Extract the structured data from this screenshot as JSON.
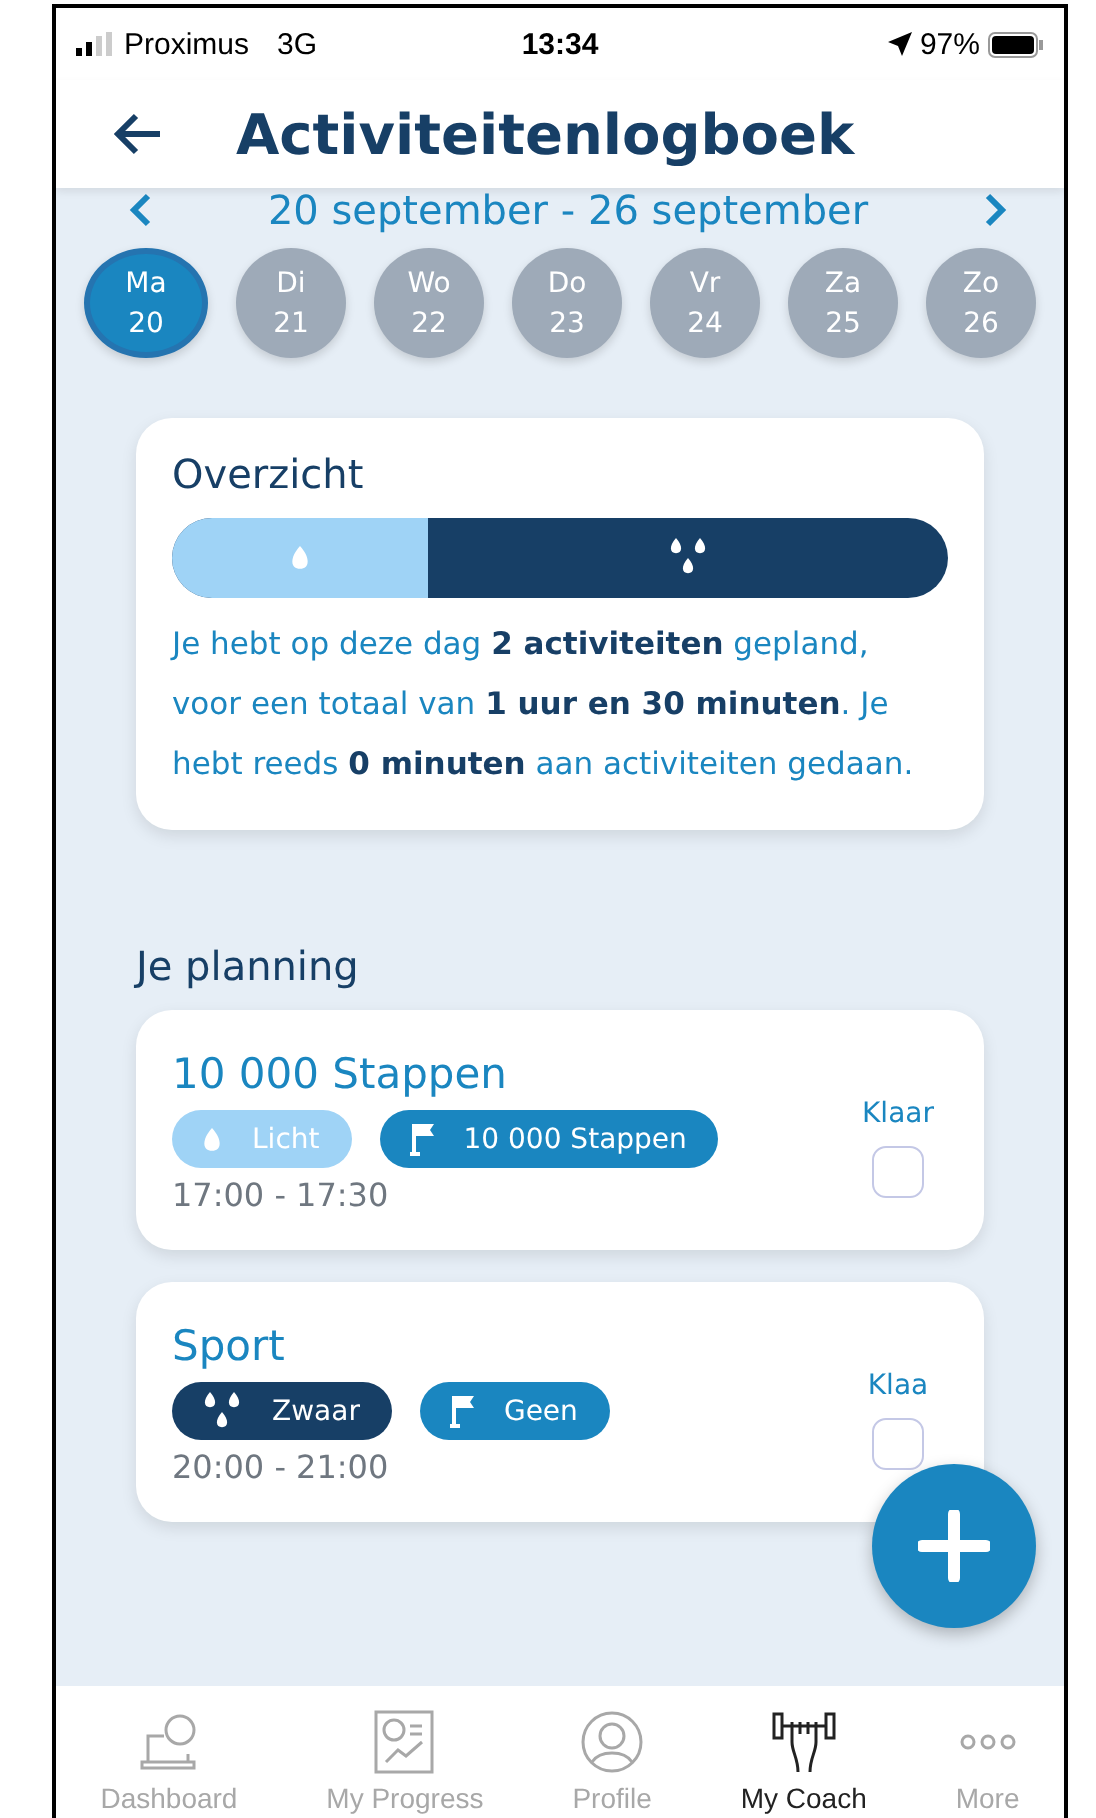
{
  "status_bar": {
    "carrier": "Proximus",
    "network": "3G",
    "time": "13:34",
    "battery": "97%"
  },
  "header": {
    "title": "Activiteitenlogboek"
  },
  "week": {
    "range": "20 september - 26 september",
    "days": [
      {
        "name": "Ma",
        "date": "20",
        "selected": true
      },
      {
        "name": "Di",
        "date": "21",
        "selected": false
      },
      {
        "name": "Wo",
        "date": "22",
        "selected": false
      },
      {
        "name": "Do",
        "date": "23",
        "selected": false
      },
      {
        "name": "Vr",
        "date": "24",
        "selected": false
      },
      {
        "name": "Za",
        "date": "25",
        "selected": false
      },
      {
        "name": "Zo",
        "date": "26",
        "selected": false
      }
    ]
  },
  "overview": {
    "title": "Overzicht",
    "level": 0.33,
    "text": "Je hebt op deze dag **2 activiteiten** gepland, voor een totaal van **1 uur en 30 minuten**. Je hebt reeds **0 minuten** aan activiteiten gedaan."
  },
  "planning": {
    "title": "Je planning",
    "items": [
      {
        "title": "10 000 Stappen",
        "tags": [
          {
            "kind": "light",
            "label": "Licht"
          },
          {
            "kind": "goal",
            "label": "10 000 Stappen"
          }
        ],
        "time": "17:00 - 17:30",
        "done_label": "Klaar",
        "checked": false
      },
      {
        "title": "Sport",
        "tags": [
          {
            "kind": "heavy",
            "label": "Zwaar"
          },
          {
            "kind": "goal",
            "label": "Geen"
          }
        ],
        "time": "20:00 - 21:00",
        "done_label": "Klaa",
        "checked": false
      }
    ]
  },
  "tab_bar": [
    {
      "kind": "dashboard",
      "label": "Dashboard",
      "selected": false
    },
    {
      "kind": "progress",
      "label": "My Progress",
      "selected": false
    },
    {
      "kind": "profile",
      "label": "Profile",
      "selected": false
    },
    {
      "kind": "coach",
      "label": "My Coach",
      "selected": true
    },
    {
      "kind": "more",
      "label": "More",
      "selected": false
    }
  ]
}
